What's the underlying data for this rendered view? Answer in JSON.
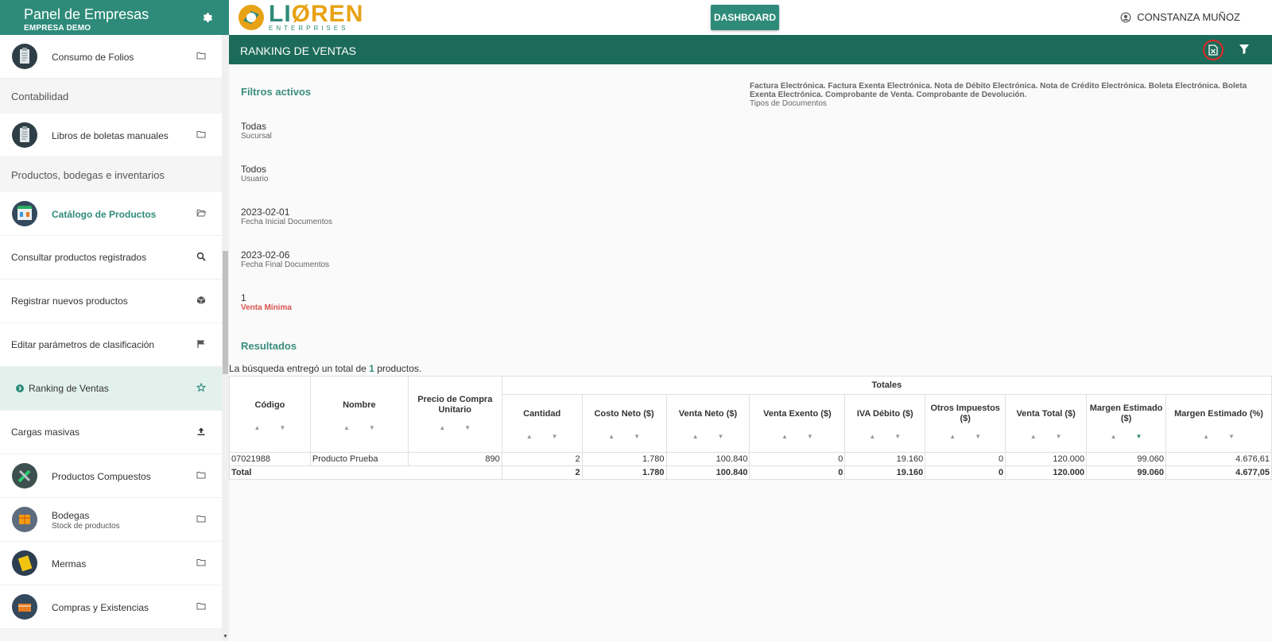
{
  "sidebar": {
    "title": "Panel de Empresas",
    "subtitle": "EMPRESA DEMO",
    "items": [
      {
        "kind": "item",
        "label": "Consumo de Folios",
        "sub": "",
        "icon": "folder-icon",
        "avatar": "clipboard-avatar"
      },
      {
        "kind": "section",
        "label": "Contabilidad"
      },
      {
        "kind": "item",
        "label": "Libros de boletas manuales",
        "sub": "",
        "icon": "folder-icon",
        "avatar": "clipboard-avatar"
      },
      {
        "kind": "section",
        "label": "Productos, bodegas e inventarios"
      },
      {
        "kind": "item",
        "label": "Catálogo de Productos",
        "sub": "",
        "icon": "folder-open-icon",
        "avatar": "store-avatar"
      },
      {
        "kind": "plain",
        "label": "Consultar productos registrados",
        "icon": "search-icon"
      },
      {
        "kind": "plain",
        "label": "Registrar nuevos productos",
        "icon": "box-icon"
      },
      {
        "kind": "plain",
        "label": "Editar parámetros de clasificación",
        "icon": "flag-icon"
      },
      {
        "kind": "selected",
        "label": "Ranking de Ventas",
        "icon": "star-icon"
      },
      {
        "kind": "plain",
        "label": "Cargas masivas",
        "icon": "upload-icon"
      },
      {
        "kind": "item",
        "label": "Productos Compuestos",
        "sub": "",
        "icon": "folder-icon",
        "avatar": "tools-avatar"
      },
      {
        "kind": "item",
        "label": "Bodegas",
        "sub": "Stock de productos",
        "icon": "folder-icon",
        "avatar": "warehouse-avatar"
      },
      {
        "kind": "item",
        "label": "Mermas",
        "sub": "",
        "icon": "folder-icon",
        "avatar": "notebook-avatar"
      },
      {
        "kind": "item",
        "label": "Compras y Existencias",
        "sub": "",
        "icon": "folder-icon",
        "avatar": "cart-avatar"
      }
    ]
  },
  "topbar": {
    "logo_name_a": "LI",
    "logo_name_b": "REN",
    "logo_sub": "ENTERPRISES",
    "dashboard_label": "DASHBOARD",
    "user_name": "CONSTANZA MUÑOZ"
  },
  "section": {
    "title": "RANKING DE VENTAS"
  },
  "filters": {
    "heading": "Filtros activos",
    "doc_types_value": "Factura Electrónica. Factura Exenta Electrónica. Nota de Débito Electrónica. Nota de Crédito Electrónica. Boleta Electrónica. Boleta Exenta Electrónica. Comprobante de Venta. Comprobante de Devolución.",
    "doc_types_label": "Tipos de Documentos",
    "sucursal_value": "Todas",
    "sucursal_label": "Sucursal",
    "usuario_value": "Todos",
    "usuario_label": "Usuario",
    "fecha_inicial_value": "2023-02-01",
    "fecha_inicial_label": "Fecha Inicial Documentos",
    "fecha_final_value": "2023-02-06",
    "fecha_final_label": "Fecha Final Documentos",
    "venta_minima_value": "1",
    "venta_minima_label": "Venta Mínima"
  },
  "results": {
    "heading": "Resultados",
    "summary_pre": "La búsqueda entregó un total de",
    "summary_count": "1",
    "summary_post": "productos."
  },
  "table": {
    "group_header": "Totales",
    "columns": [
      {
        "label": "Código"
      },
      {
        "label": "Nombre"
      },
      {
        "label": "Precio de Compra Unitario"
      },
      {
        "label": "Cantidad"
      },
      {
        "label": "Costo Neto ($)"
      },
      {
        "label": "Venta Neto ($)"
      },
      {
        "label": "Venta Exento ($)"
      },
      {
        "label": "IVA Débito ($)"
      },
      {
        "label": "Otros Impuestos ($)"
      },
      {
        "label": "Venta Total ($)"
      },
      {
        "label": "Margen Estimado ($)"
      },
      {
        "label": "Margen Estimado (%)"
      }
    ],
    "rows": [
      [
        "07021988",
        "Producto Prueba",
        "890",
        "2",
        "1.780",
        "100.840",
        "0",
        "19.160",
        "0",
        "120.000",
        "99.060",
        "4.676,61"
      ]
    ],
    "total_row": [
      "Total",
      "2",
      "1.780",
      "100.840",
      "0",
      "19.160",
      "0",
      "120.000",
      "99.060",
      "4.677,05"
    ]
  }
}
